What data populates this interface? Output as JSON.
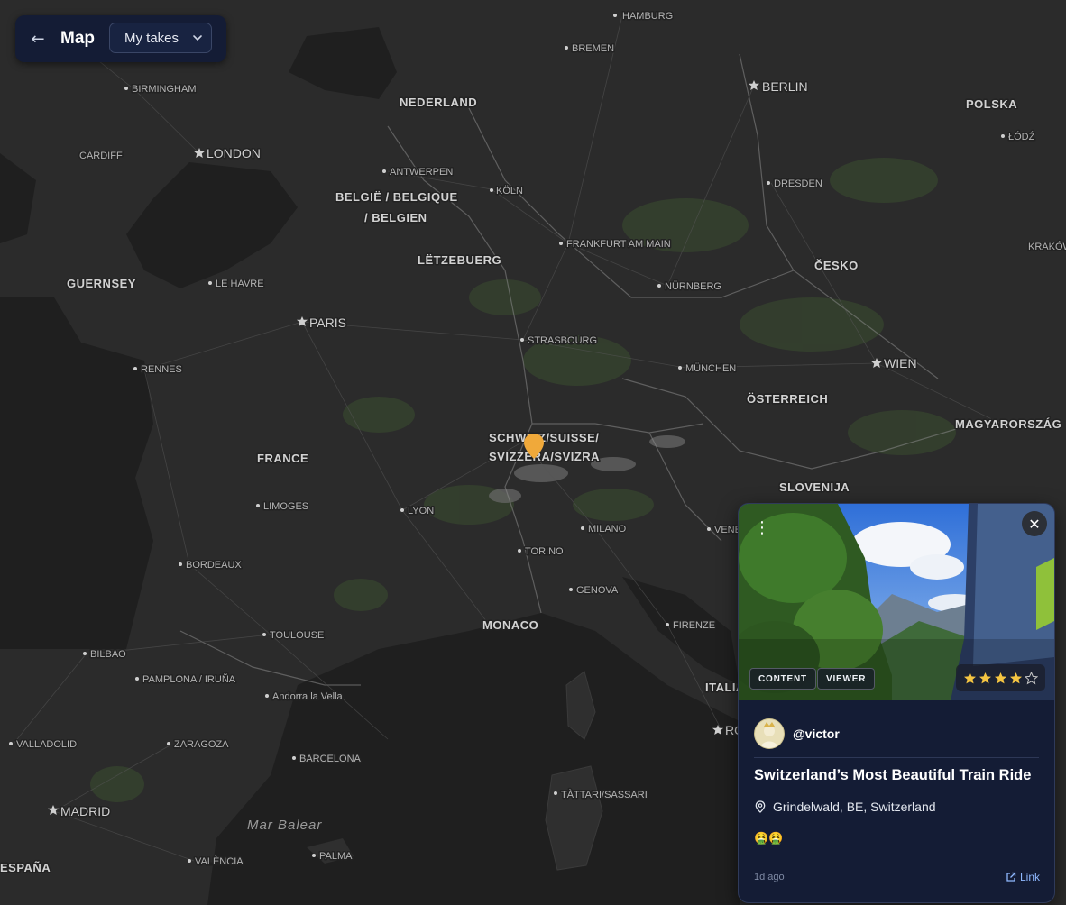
{
  "header": {
    "back_icon": "arrow-left-icon",
    "title": "Map",
    "filter": {
      "selected": "My takes",
      "icon": "chevron-down-icon"
    }
  },
  "map": {
    "countries": [
      "NEDERLAND",
      "BELGIË / BELGIQUE",
      "/ BELGIEN",
      "LËTZEBUERG",
      "GUERNSEY",
      "FRANCE",
      "SCHWEIZ/SUISSE/",
      "SVIZZERA/SVIZRA",
      "MONACO",
      "POLSKA",
      "ČESKO",
      "ÖSTERREICH",
      "MAGYARORSZÁG",
      "SLOVENIJA",
      "ITALIA",
      "ESPAÑA"
    ],
    "capitals": [
      "HAMBURG",
      "BERLIN",
      "LONDON",
      "PARIS",
      "WIEN",
      "MADRID",
      "ROMA"
    ],
    "cities": [
      "BREMEN",
      "BIRMINGHAM",
      "CARDIFF",
      "ANTWERPEN",
      "KÖLN",
      "DRESDEN",
      "ŁÓDŹ",
      "KRAKÓW",
      "FRANKFURT AM MAIN",
      "LE HAVRE",
      "NÜRNBERG",
      "STRASBOURG",
      "RENNES",
      "MÜNCHEN",
      "LIMOGES",
      "LYON",
      "MILANO",
      "VENEZIA",
      "TORINO",
      "BORDEAUX",
      "GENOVA",
      "FIRENZE",
      "TOULOUSE",
      "BILBAO",
      "PAMPLONA / IRUÑA",
      "Andorra la Vella",
      "VALLADOLID",
      "ZARAGOZA",
      "BARCELONA",
      "TÀTTARI/SASSARI",
      "PALMA",
      "VALÈNCIA"
    ],
    "seas": [
      "Mar Balear"
    ],
    "marker_icon": "map-pin-icon",
    "marker_color": "#f0a93a"
  },
  "card": {
    "menu_icon": "more-vertical-icon",
    "close_icon": "close-icon",
    "tags": [
      "CONTENT",
      "VIEWER"
    ],
    "rating": 4,
    "rating_max": 5,
    "star_color": "#f5c542",
    "username": "@victor",
    "title": "Switzerland’s Most Beautiful Train Ride",
    "location_icon": "map-pin-outline-icon",
    "location": "Grindelwald, BE, Switzerland",
    "emoji": "🤮🤮",
    "time": "1d ago",
    "link_icon": "external-link-icon",
    "link_label": "Link"
  }
}
